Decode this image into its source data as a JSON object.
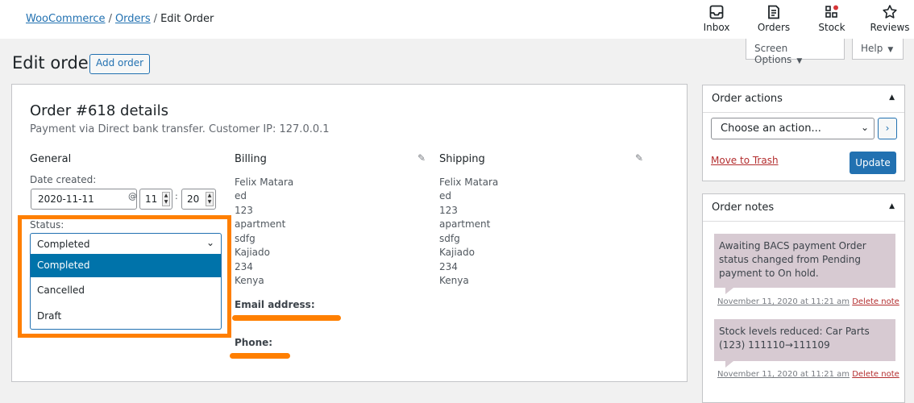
{
  "breadcrumb": {
    "home": "WooCommerce",
    "orders": "Orders",
    "current": "Edit Order",
    "sep": "/"
  },
  "toolbar": {
    "inbox": "Inbox",
    "orders": "Orders",
    "stock": "Stock",
    "reviews": "Reviews"
  },
  "screen_options": "Screen Options",
  "help": "Help",
  "page_title": "Edit order",
  "add_order": "Add order",
  "order": {
    "heading": "Order #618 details",
    "subtitle": "Payment via Direct bank transfer. Customer IP: 127.0.0.1"
  },
  "general": {
    "heading": "General",
    "date_label": "Date created:",
    "date_value": "2020-11-11",
    "at": "@",
    "hour": "11",
    "minute": "20",
    "colon": ":",
    "status_label": "Status:",
    "status_value": "Completed",
    "status_options": [
      "Completed",
      "Cancelled",
      "Draft"
    ]
  },
  "billing": {
    "heading": "Billing",
    "lines": [
      "Felix Matara",
      "ed",
      "123",
      "apartment",
      "sdfg",
      "Kajiado",
      "234",
      "Kenya"
    ],
    "email_label": "Email address:",
    "phone_label": "Phone:"
  },
  "shipping": {
    "heading": "Shipping",
    "lines": [
      "Felix Matara",
      "ed",
      "123",
      "apartment",
      "sdfg",
      "Kajiado",
      "234",
      "Kenya"
    ]
  },
  "order_actions": {
    "heading": "Order actions",
    "select_value": "Choose an action...",
    "go": "›",
    "trash": "Move to Trash",
    "update": "Update"
  },
  "order_notes": {
    "heading": "Order notes",
    "notes": [
      {
        "text": "Awaiting BACS payment Order status changed from Pending payment to On hold.",
        "date": "November 11, 2020 at 11:21 am",
        "delete": "Delete note"
      },
      {
        "text": "Stock levels reduced: Car Parts (123) 111110→111109",
        "date": "November 11, 2020 at 11:21 am",
        "delete": "Delete note"
      }
    ]
  },
  "colors": {
    "accent": "#2271b1",
    "highlight": "#ff7f00",
    "note_bg": "#d7cad2",
    "danger": "#b32d2e"
  }
}
